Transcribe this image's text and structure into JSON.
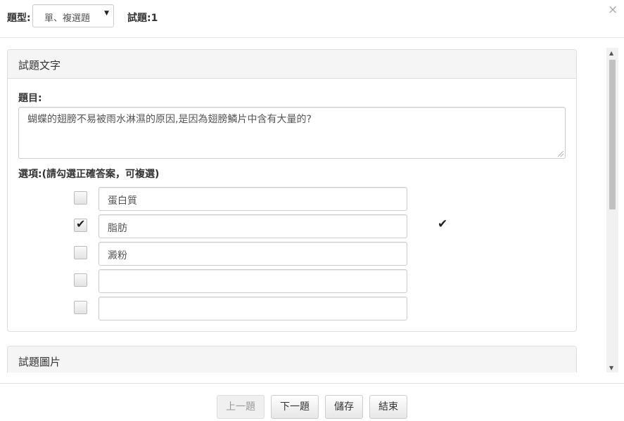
{
  "header": {
    "type_label": "題型:",
    "type_select_value": "單、複選題",
    "question_number": "試題:1",
    "close_glyph": "×"
  },
  "panel_question": {
    "heading": "試題文字",
    "question_label": "題目:",
    "question_text": "蝴蝶的翅膀不易被雨水淋濕的原因,是因為翅膀鱗片中含有大量的?",
    "options_label": "選項:(請勾選正確答案，可複選)",
    "options": [
      {
        "text": "蛋白質",
        "checked": false,
        "correct": false
      },
      {
        "text": "脂肪",
        "checked": true,
        "correct": true
      },
      {
        "text": "澱粉",
        "checked": false,
        "correct": false
      },
      {
        "text": "",
        "checked": false,
        "correct": false
      },
      {
        "text": "",
        "checked": false,
        "correct": false
      }
    ]
  },
  "panel_image": {
    "heading": "試題圖片"
  },
  "footer": {
    "prev_label": "上一題",
    "next_label": "下一題",
    "save_label": "儲存",
    "finish_label": "結束"
  },
  "icons": {
    "checkmark": "check-icon",
    "scroll_up": "scroll-up-arrow-icon",
    "scroll_down": "scroll-down-arrow-icon"
  }
}
